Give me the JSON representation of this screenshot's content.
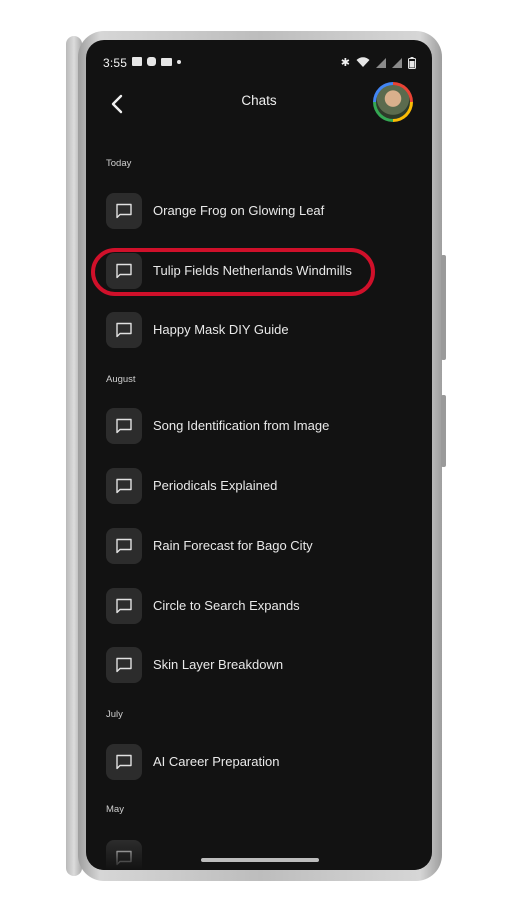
{
  "status_bar": {
    "time": "3:55"
  },
  "header": {
    "title": "Chats"
  },
  "sections": [
    {
      "label": "Today",
      "items": [
        "Orange Frog on Glowing Leaf",
        "Tulip Fields Netherlands Windmills",
        "Happy Mask DIY Guide"
      ]
    },
    {
      "label": "August",
      "items": [
        "Song Identification from Image",
        "Periodicals Explained",
        "Rain Forecast for Bago City",
        "Circle to Search Expands",
        "Skin Layer Breakdown"
      ]
    },
    {
      "label": "July",
      "items": [
        "AI Career Preparation"
      ]
    },
    {
      "label": "May",
      "items": []
    }
  ],
  "highlighted_item": "Tulip Fields Netherlands Windmills",
  "colors": {
    "background": "#121212",
    "highlight": "#d0102a",
    "icon_tile": "#2c2c2c"
  }
}
